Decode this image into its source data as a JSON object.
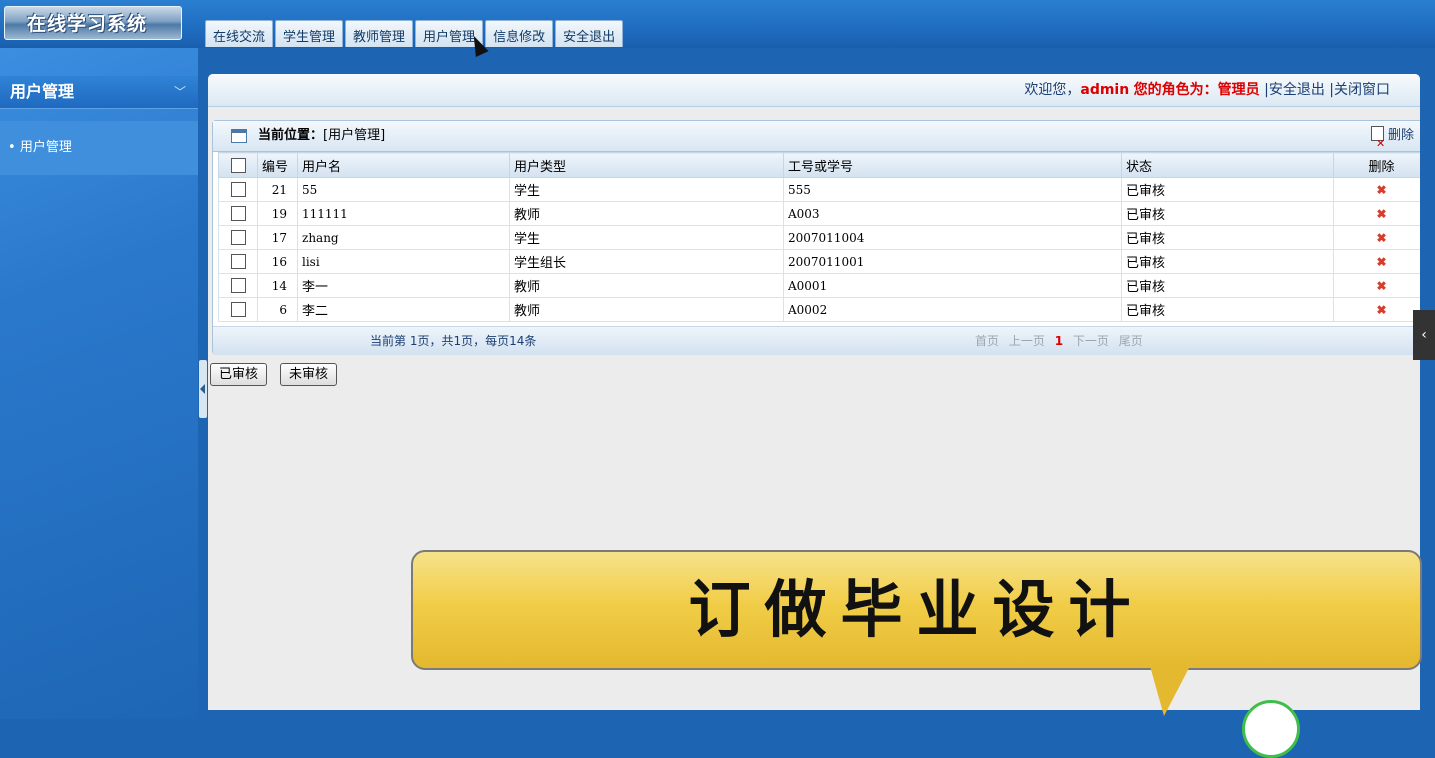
{
  "app": {
    "logo_text": "在线学习系统"
  },
  "topnav": [
    "在线交流",
    "学生管理",
    "教师管理",
    "用户管理",
    "信息修改",
    "安全退出"
  ],
  "sidebar": {
    "title": "用户管理",
    "chevron": "chevron-down-icon",
    "items": [
      {
        "label": "用户管理"
      }
    ]
  },
  "header": {
    "welcome": "欢迎您，",
    "user": "admin",
    "role_label": "您的角色为：管理员",
    "logout": "安全退出",
    "close": "关闭窗口",
    "sep": "|"
  },
  "breadcrumb": {
    "label": "当前位置：",
    "value": "[用户管理]"
  },
  "toolbar": {
    "delete_label": "删除"
  },
  "table": {
    "columns": [
      "编号",
      "用户名",
      "用户类型",
      "工号或学号",
      "状态",
      "删除"
    ],
    "rows": [
      {
        "id": "21",
        "username": "55",
        "type": "学生",
        "number": "555",
        "status": "已审核"
      },
      {
        "id": "19",
        "username": "111111",
        "type": "教师",
        "number": "A003",
        "status": "已审核"
      },
      {
        "id": "17",
        "username": "zhang",
        "type": "学生",
        "number": "2007011004",
        "status": "已审核"
      },
      {
        "id": "16",
        "username": "lisi",
        "type": "学生组长",
        "number": "2007011001",
        "status": "已审核"
      },
      {
        "id": "14",
        "username": "李一",
        "type": "教师",
        "number": "A0001",
        "status": "已审核"
      },
      {
        "id": "6",
        "username": "李二",
        "type": "教师",
        "number": "A0002",
        "status": "已审核"
      }
    ]
  },
  "pager": {
    "info": "当前第 1页，共1页，每页14条",
    "first": "首页",
    "prev": "上一页",
    "current": "1",
    "next": "下一页",
    "last": "尾页"
  },
  "buttons": {
    "approved": "已审核",
    "unapproved": "未审核"
  },
  "banner": {
    "text": "订做毕业设计"
  },
  "colors": {
    "accent": "#1f6cc0",
    "danger": "#d00000",
    "banner": "#f1cd47"
  }
}
